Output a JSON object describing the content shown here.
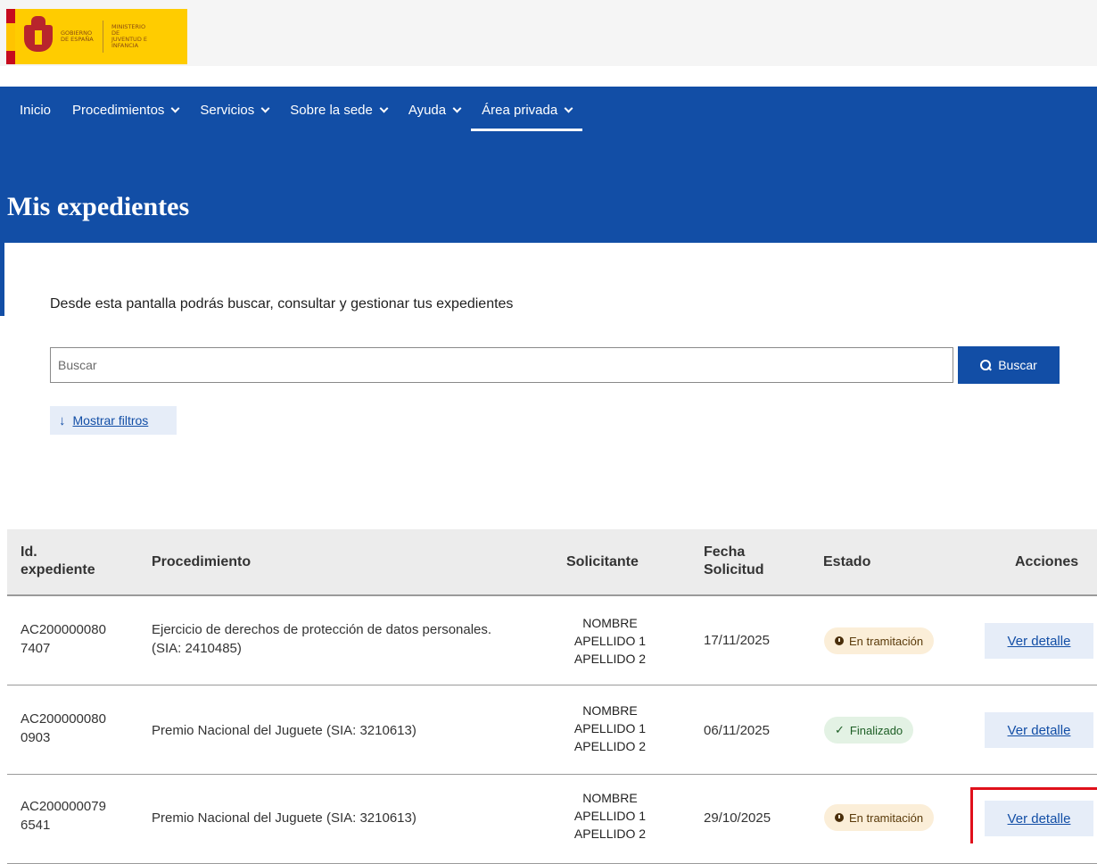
{
  "header": {
    "logo_gov": "GOBIERNO DE ESPAÑA",
    "logo_ministry": "MINISTERIO DE JUVENTUD E INFANCIA"
  },
  "nav": {
    "items": [
      {
        "label": "Inicio",
        "has_menu": false
      },
      {
        "label": "Procedimientos",
        "has_menu": true
      },
      {
        "label": "Servicios",
        "has_menu": true
      },
      {
        "label": "Sobre la sede",
        "has_menu": true
      },
      {
        "label": "Ayuda",
        "has_menu": true
      },
      {
        "label": "Área privada",
        "has_menu": true,
        "active": true
      }
    ]
  },
  "page": {
    "title": "Mis expedientes",
    "intro": "Desde esta pantalla podrás buscar, consultar y gestionar tus expedientes"
  },
  "search": {
    "placeholder": "Buscar",
    "button_label": "Buscar",
    "filters_label": "Mostrar filtros"
  },
  "table": {
    "headers": {
      "id": "Id. expediente",
      "procedimiento": "Procedimiento",
      "solicitante": "Solicitante",
      "fecha": "Fecha Solicitud",
      "estado": "Estado",
      "acciones": "Acciones"
    },
    "rows": [
      {
        "id_line1": "AC200000080",
        "id_line2": "7407",
        "proc_line1": "Ejercicio de derechos de protección de datos personales.",
        "proc_line2": "(SIA: 2410485)",
        "sol1": "NOMBRE",
        "sol2": "APELLIDO 1",
        "sol3": "APELLIDO 2",
        "fecha": "17/11/2025",
        "estado": "En tramitación",
        "action": "Ver detalle"
      },
      {
        "id_line1": "AC200000080",
        "id_line2": "0903",
        "proc_line1": "Premio Nacional del Juguete (SIA: 3210613)",
        "proc_line2": "",
        "sol1": "NOMBRE",
        "sol2": "APELLIDO 1",
        "sol3": "APELLIDO 2",
        "fecha": "06/11/2025",
        "estado": "Finalizado",
        "action": "Ver detalle"
      },
      {
        "id_line1": "AC200000079",
        "id_line2": "6541",
        "proc_line1": "Premio Nacional del Juguete (SIA: 3210613)",
        "proc_line2": "",
        "sol1": "NOMBRE",
        "sol2": "APELLIDO 1",
        "sol3": "APELLIDO 2",
        "fecha": "29/10/2025",
        "estado": "En tramitación",
        "action": "Ver detalle"
      }
    ]
  },
  "colors": {
    "primary": "#124ea6",
    "badge_progress_bg": "#fbeed8",
    "badge_done_bg": "#e3f2e4",
    "highlight": "#e0101b"
  }
}
